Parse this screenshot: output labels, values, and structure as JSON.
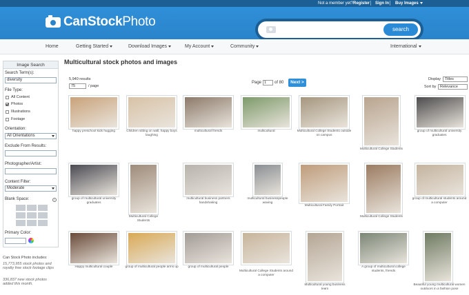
{
  "topbar": {
    "not_member": "Not a member yet?",
    "register": "Register",
    "sign_in": "Sign In",
    "buy_images": "Buy Images"
  },
  "logo": {
    "bold": "CanStock",
    "thin": "Photo"
  },
  "search": {
    "placeholder": "",
    "button": "search"
  },
  "nav": {
    "home": "Home",
    "getting_started": "Getting Started",
    "download_images": "Download Images",
    "my_account": "My Account",
    "community": "Community",
    "international": "International"
  },
  "sidebar": {
    "title": "Image Search",
    "search_term_label": "Search Term(s):",
    "search_term_value": "diversity",
    "file_type_label": "File Type:",
    "file_types": [
      {
        "label": "All Content",
        "checked": false
      },
      {
        "label": "Photos",
        "checked": true
      },
      {
        "label": "Illustrations",
        "checked": false
      },
      {
        "label": "Footage",
        "checked": false
      }
    ],
    "orientation_label": "Orientation:",
    "orientation_value": "All Orientations",
    "exclude_label": "Exclude From Results:",
    "photographer_label": "Photographer/Artist:",
    "content_filter_label": "Content Filter:",
    "content_filter_value": "Moderate",
    "blank_space_label": "Blank Space:",
    "primary_color_label": "Primary Color:"
  },
  "stats": {
    "intro": "Can Stock Photo includes:",
    "line1": "15,773,955 stock photos and royalty free stock footage clips",
    "line2": "336,837 new stock photos added this month."
  },
  "main": {
    "title": "Multicultural stock photos and images",
    "results": "5,940 results",
    "per_page_value": "75",
    "per_page_label": "/ page",
    "page_label": "Page",
    "page_value": "1",
    "of_label": "of 80",
    "next": "Next >",
    "display_label": "Display",
    "display_value": "Titles",
    "sort_label": "Sort by",
    "sort_value": "Relevance"
  },
  "images": [
    {
      "caption": "happy preschool kids hugging",
      "color": "#c9a27a"
    },
    {
      "caption": "Children sitting on wall, happy boys laughing",
      "color": "#d8c2a6"
    },
    {
      "caption": "multicultural friends",
      "color": "#8c7a6a"
    },
    {
      "caption": "multicultural",
      "color": "#7d9a6a"
    },
    {
      "caption": "Multicultural College Students outside on campus",
      "color": "#a5967e"
    },
    {
      "caption": "Multicultural College Students",
      "color": "#b9a48f"
    },
    {
      "caption": "group of multicultural university graduates",
      "color": "#4d4c4d"
    },
    {
      "caption": "group of multicultural university graduates",
      "color": "#4a4a52"
    },
    {
      "caption": "Multicultural College Students",
      "color": "#9e8b7a"
    },
    {
      "caption": "multicultural business partners handshaking",
      "color": "#b7b3ad"
    },
    {
      "caption": "multicultural businesspeople waving",
      "color": "#8a8e93"
    },
    {
      "caption": "Multicultural Family Portrait",
      "color": "#bf9c7b"
    },
    {
      "caption": "Multicultural College Students",
      "color": "#9c7c62"
    },
    {
      "caption": "group of multicultural students around a computer",
      "color": "#c4b39e"
    },
    {
      "caption": "Happy multicultural couple",
      "color": "#6a4b3a"
    },
    {
      "caption": "group of multicultural people arms up",
      "color": "#d9a955"
    },
    {
      "caption": "group of multicultural people",
      "color": "#a29c96"
    },
    {
      "caption": "Multicultural College Students around a computer",
      "color": "#c7b49b"
    },
    {
      "caption": "Multicultural young business team",
      "color": "#b4a695"
    },
    {
      "caption": "A group of multicultural college students, friends",
      "color": "#7b8676"
    },
    {
      "caption": "Beautiful young multicultural women outdoors in a fashion pose",
      "color": "#6f7b62"
    }
  ]
}
